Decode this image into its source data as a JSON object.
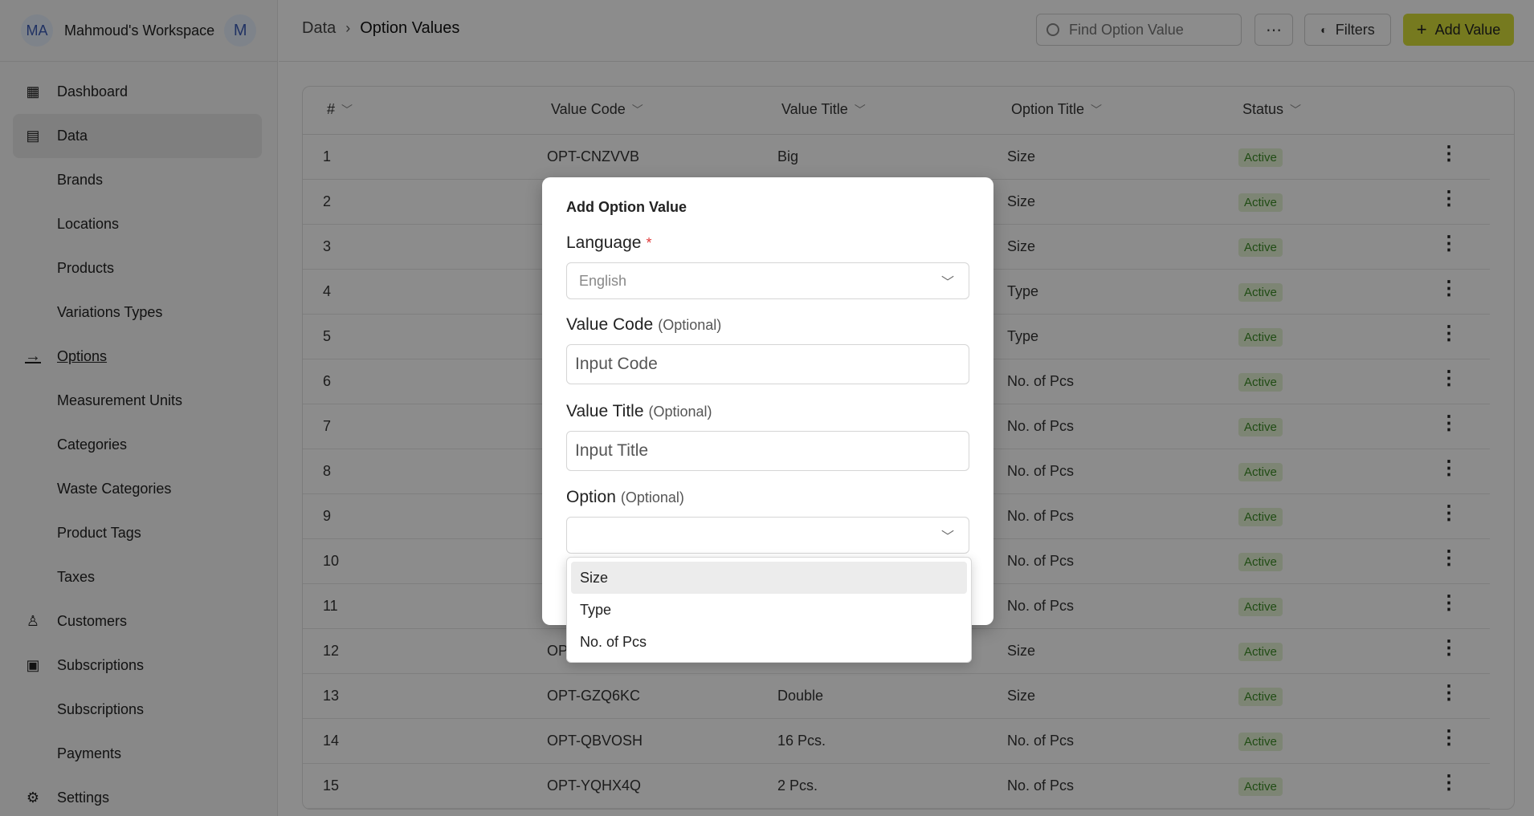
{
  "workspace": {
    "avatar": "MA",
    "name": "Mahmoud's Workspace",
    "user_avatar": "M"
  },
  "sidebar": {
    "items": [
      {
        "label": "Dashboard",
        "icon": "grid-icon",
        "level": "top"
      },
      {
        "label": "Data",
        "icon": "document-icon",
        "level": "top",
        "active": true
      },
      {
        "label": "Brands",
        "level": "sub"
      },
      {
        "label": "Locations",
        "level": "sub"
      },
      {
        "label": "Products",
        "level": "sub"
      },
      {
        "label": "Variations Types",
        "level": "sub"
      },
      {
        "label": "Options",
        "icon": "arrow-right-icon",
        "level": "top",
        "current": true
      },
      {
        "label": "Measurement Units",
        "level": "sub"
      },
      {
        "label": "Categories",
        "level": "sub"
      },
      {
        "label": "Waste Categories",
        "level": "sub"
      },
      {
        "label": "Product Tags",
        "level": "sub"
      },
      {
        "label": "Taxes",
        "level": "sub"
      },
      {
        "label": "Customers",
        "icon": "user-icon",
        "level": "top"
      },
      {
        "label": "Subscriptions",
        "icon": "calendar-icon",
        "level": "top"
      },
      {
        "label": "Subscriptions",
        "level": "sub"
      },
      {
        "label": "Payments",
        "level": "sub"
      },
      {
        "label": "Settings",
        "icon": "gear-icon",
        "level": "top"
      }
    ]
  },
  "header": {
    "breadcrumb": [
      "Data",
      "Option Values"
    ],
    "search_placeholder": "Find Option Value",
    "more_label": "⋯",
    "filters_label": "Filters",
    "add_label": "Add Value"
  },
  "table": {
    "columns": [
      "#",
      "Value Code",
      "Value Title",
      "Option Title",
      "Status"
    ],
    "rows": [
      {
        "num": "1",
        "code": "OPT-CNZVVB",
        "title": "Big",
        "option": "Size",
        "status": "Active"
      },
      {
        "num": "2",
        "code": "",
        "title": "",
        "option": "Size",
        "status": "Active"
      },
      {
        "num": "3",
        "code": "",
        "title": "",
        "option": "Size",
        "status": "Active"
      },
      {
        "num": "4",
        "code": "",
        "title": "",
        "option": "Type",
        "status": "Active"
      },
      {
        "num": "5",
        "code": "",
        "title": "",
        "option": "Type",
        "status": "Active"
      },
      {
        "num": "6",
        "code": "",
        "title": "",
        "option": "No. of Pcs",
        "status": "Active"
      },
      {
        "num": "7",
        "code": "",
        "title": "",
        "option": "No. of Pcs",
        "status": "Active"
      },
      {
        "num": "8",
        "code": "",
        "title": "",
        "option": "No. of Pcs",
        "status": "Active"
      },
      {
        "num": "9",
        "code": "",
        "title": "",
        "option": "No. of Pcs",
        "status": "Active"
      },
      {
        "num": "10",
        "code": "",
        "title": "",
        "option": "No. of Pcs",
        "status": "Active"
      },
      {
        "num": "11",
        "code": "",
        "title": "",
        "option": "No. of Pcs",
        "status": "Active"
      },
      {
        "num": "12",
        "code": "OP",
        "title": "",
        "option": "Size",
        "status": "Active"
      },
      {
        "num": "13",
        "code": "OPT-GZQ6KC",
        "title": "Double",
        "option": "Size",
        "status": "Active"
      },
      {
        "num": "14",
        "code": "OPT-QBVOSH",
        "title": "16 Pcs.",
        "option": "No. of Pcs",
        "status": "Active"
      },
      {
        "num": "15",
        "code": "OPT-YQHX4Q",
        "title": "2 Pcs.",
        "option": "No. of Pcs",
        "status": "Active"
      }
    ]
  },
  "modal": {
    "title": "Add Option Value",
    "language_label": "Language",
    "required_mark": "*",
    "language_value": "English",
    "code_label": "Value Code",
    "code_optional": "(Optional)",
    "code_placeholder": "Input Code",
    "title_label": "Value Title",
    "title_optional": "(Optional)",
    "title_placeholder": "Input Title",
    "option_label": "Option",
    "option_optional": "(Optional)",
    "option_value": ""
  },
  "dropdown": {
    "options": [
      "Size",
      "Type",
      "No. of Pcs"
    ],
    "highlighted": "Size"
  },
  "colors": {
    "accent": "#d7df3a",
    "badge_bg": "#e4f2d4",
    "badge_text": "#3b8a25",
    "required": "#e03b3b"
  }
}
